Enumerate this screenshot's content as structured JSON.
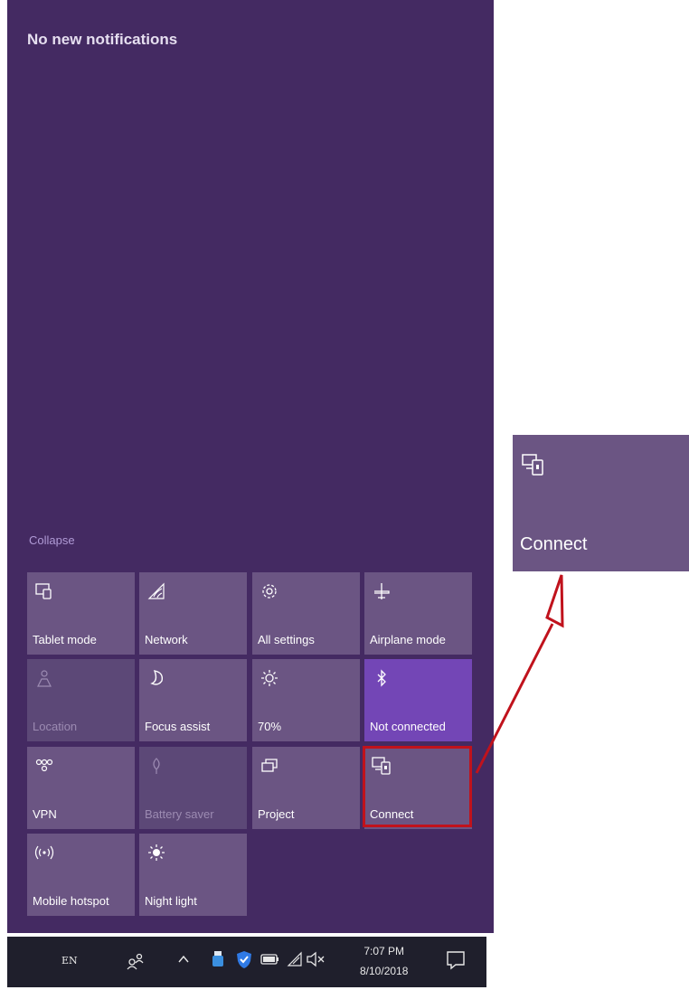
{
  "notifications": {
    "title": "No new notifications"
  },
  "collapse_label": "Collapse",
  "tiles": [
    {
      "label": "Tablet mode",
      "icon": "tablet-mode-icon",
      "state": "normal"
    },
    {
      "label": "Network",
      "icon": "network-icon",
      "state": "normal"
    },
    {
      "label": "All settings",
      "icon": "gear-icon",
      "state": "normal"
    },
    {
      "label": "Airplane mode",
      "icon": "airplane-icon",
      "state": "normal"
    },
    {
      "label": "Location",
      "icon": "location-icon",
      "state": "disabled"
    },
    {
      "label": "Focus assist",
      "icon": "moon-icon",
      "state": "normal"
    },
    {
      "label": "70%",
      "icon": "brightness-icon",
      "state": "normal"
    },
    {
      "label": "Not connected",
      "icon": "bluetooth-icon",
      "state": "active"
    },
    {
      "label": "VPN",
      "icon": "vpn-icon",
      "state": "normal"
    },
    {
      "label": "Battery saver",
      "icon": "battery-saver-icon",
      "state": "disabled"
    },
    {
      "label": "Project",
      "icon": "project-icon",
      "state": "normal"
    },
    {
      "label": "Connect",
      "icon": "connect-icon",
      "state": "normal"
    },
    {
      "label": "Mobile hotspot",
      "icon": "hotspot-icon",
      "state": "normal"
    },
    {
      "label": "Night light",
      "icon": "night-light-icon",
      "state": "normal"
    }
  ],
  "callout": {
    "label": "Connect",
    "icon": "connect-icon"
  },
  "taskbar": {
    "language": "EN",
    "time": "7:07 PM",
    "date": "8/10/2018"
  },
  "colors": {
    "panel": "#442a62",
    "tile": "#6b5583",
    "tile_active": "#7346b6",
    "highlight": "#c0121c"
  }
}
